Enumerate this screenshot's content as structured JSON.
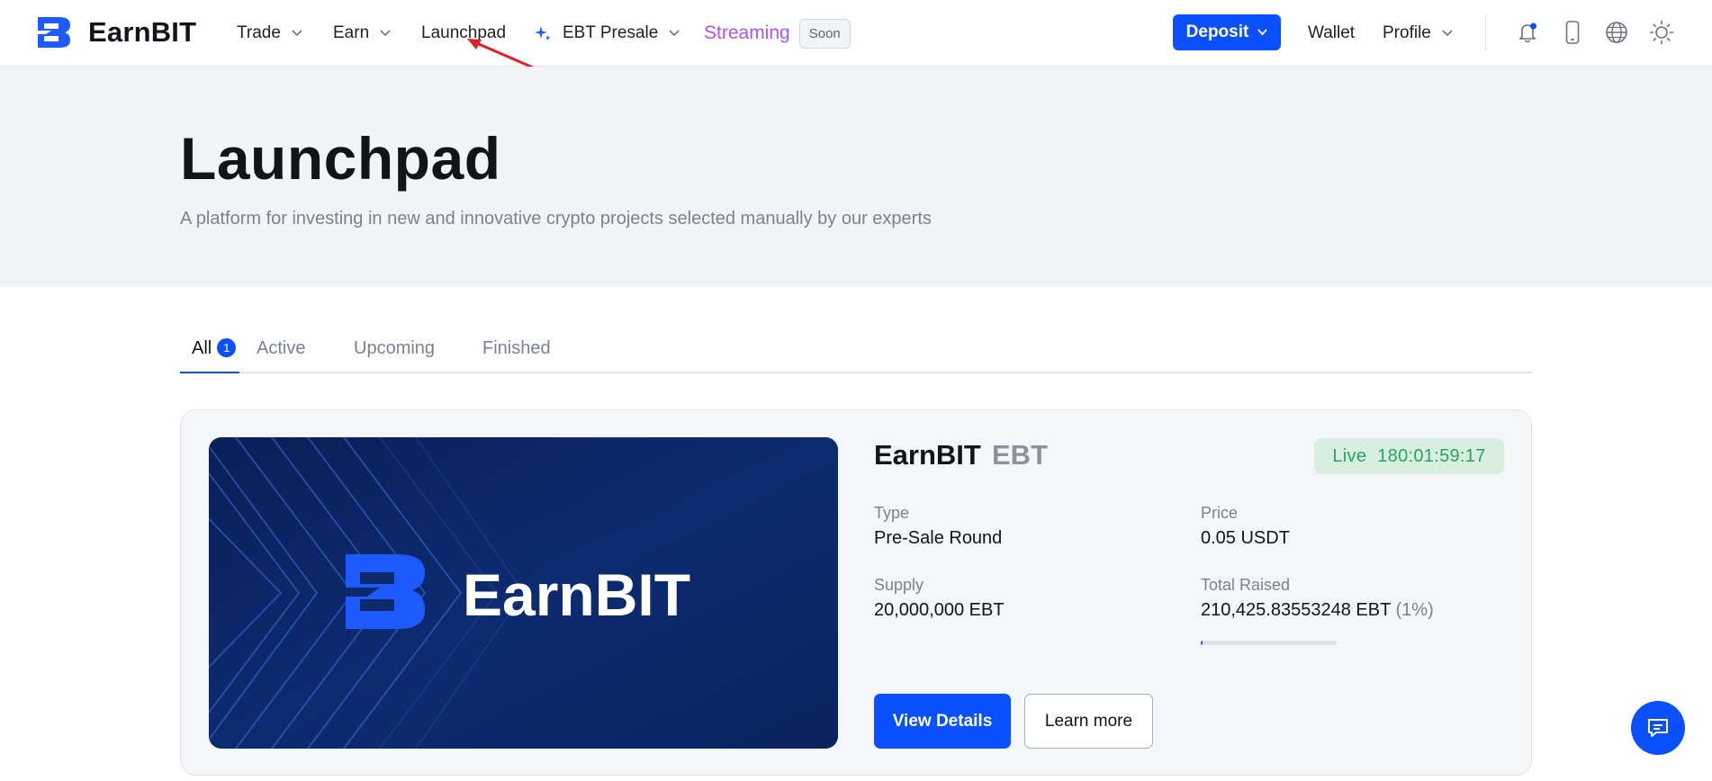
{
  "header": {
    "brand": "EarnBIT",
    "nav": {
      "trade": "Trade",
      "earn": "Earn",
      "launchpad": "Launchpad",
      "presale": "EBT Presale",
      "streaming": "Streaming",
      "soon_badge": "Soon"
    },
    "deposit_label": "Deposit",
    "wallet_label": "Wallet",
    "profile_label": "Profile",
    "icons": [
      "bell-icon",
      "mobile-icon",
      "globe-icon",
      "sun-icon"
    ]
  },
  "hero": {
    "title": "Launchpad",
    "subtitle": "A platform for investing in new and innovative crypto projects selected manually by our experts"
  },
  "tabs": {
    "all": "All",
    "all_count": "1",
    "active": "Active",
    "upcoming": "Upcoming",
    "finished": "Finished"
  },
  "project": {
    "name": "EarnBIT",
    "ticker": "EBT",
    "banner_text": "EarnBIT",
    "status": "Live",
    "countdown": "180:01:59:17",
    "type_label": "Type",
    "type_value": "Pre-Sale Round",
    "price_label": "Price",
    "price_value": "0.05 USDT",
    "supply_label": "Supply",
    "supply_value": "20,000,000 EBT",
    "raised_label": "Total Raised",
    "raised_value": "210,425.83553248 EBT",
    "raised_pct": "(1%)",
    "progress_fraction": 0.01,
    "view_details_label": "View Details",
    "learn_more_label": "Learn more"
  },
  "colors": {
    "accent": "#0a50ff",
    "streaming": "#a855f7",
    "live_text": "#27a55b",
    "live_bg": "#d8efe0",
    "banner_bg": "#0d2a6b"
  }
}
